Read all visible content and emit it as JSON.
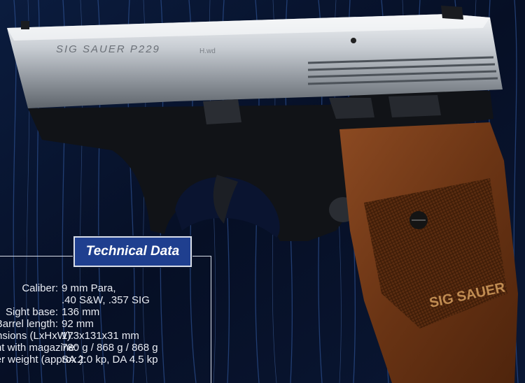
{
  "slide_engraving": "SIG SAUER P229",
  "grip_logo": "SIG SAUER",
  "panel_title": "Technical Data",
  "specs": [
    {
      "label": "Caliber:",
      "values": [
        "9 mm Para,",
        ".40 S&W, .357 SIG"
      ]
    },
    {
      "label": "Sight base:",
      "values": [
        "136 mm"
      ]
    },
    {
      "label": "Barrel length:",
      "values": [
        "92 mm"
      ]
    },
    {
      "label": "Dimensions (LxHxW):",
      "values": [
        "173x131x31 mm"
      ]
    },
    {
      "label": "Weight with magazine:",
      "values": [
        "780 g / 868 g / 868 g"
      ]
    },
    {
      "label": "Trigger weight (approx.):",
      "values": [
        "SA 2.0 kp, DA 4.5 kp"
      ]
    }
  ],
  "colors": {
    "panel_title_bg": "#1f3f8f",
    "background": "#050a1a"
  }
}
